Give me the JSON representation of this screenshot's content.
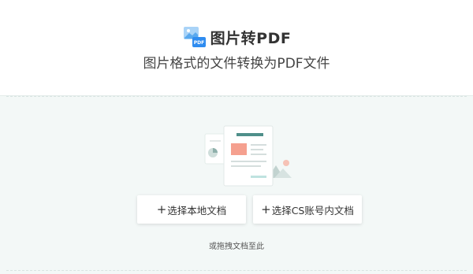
{
  "header": {
    "icon": "image-to-pdf-icon",
    "icon_badge": "PDF",
    "title": "图片转PDF",
    "subtitle": "图片格式的文件转换为PDF文件"
  },
  "upload": {
    "illustration": "document-upload-illustration",
    "local_button": {
      "plus": "+",
      "label": "选择本地文档"
    },
    "cs_button": {
      "plus": "+",
      "label": "选择CS账号内文档"
    },
    "hint": "或拖拽文档至此"
  },
  "colors": {
    "accent": "#2f8cf0",
    "drop_zone_bg": "#f3f8f7",
    "illustration_teal": "#4f8f8a",
    "illustration_salmon": "#f5a08f"
  }
}
